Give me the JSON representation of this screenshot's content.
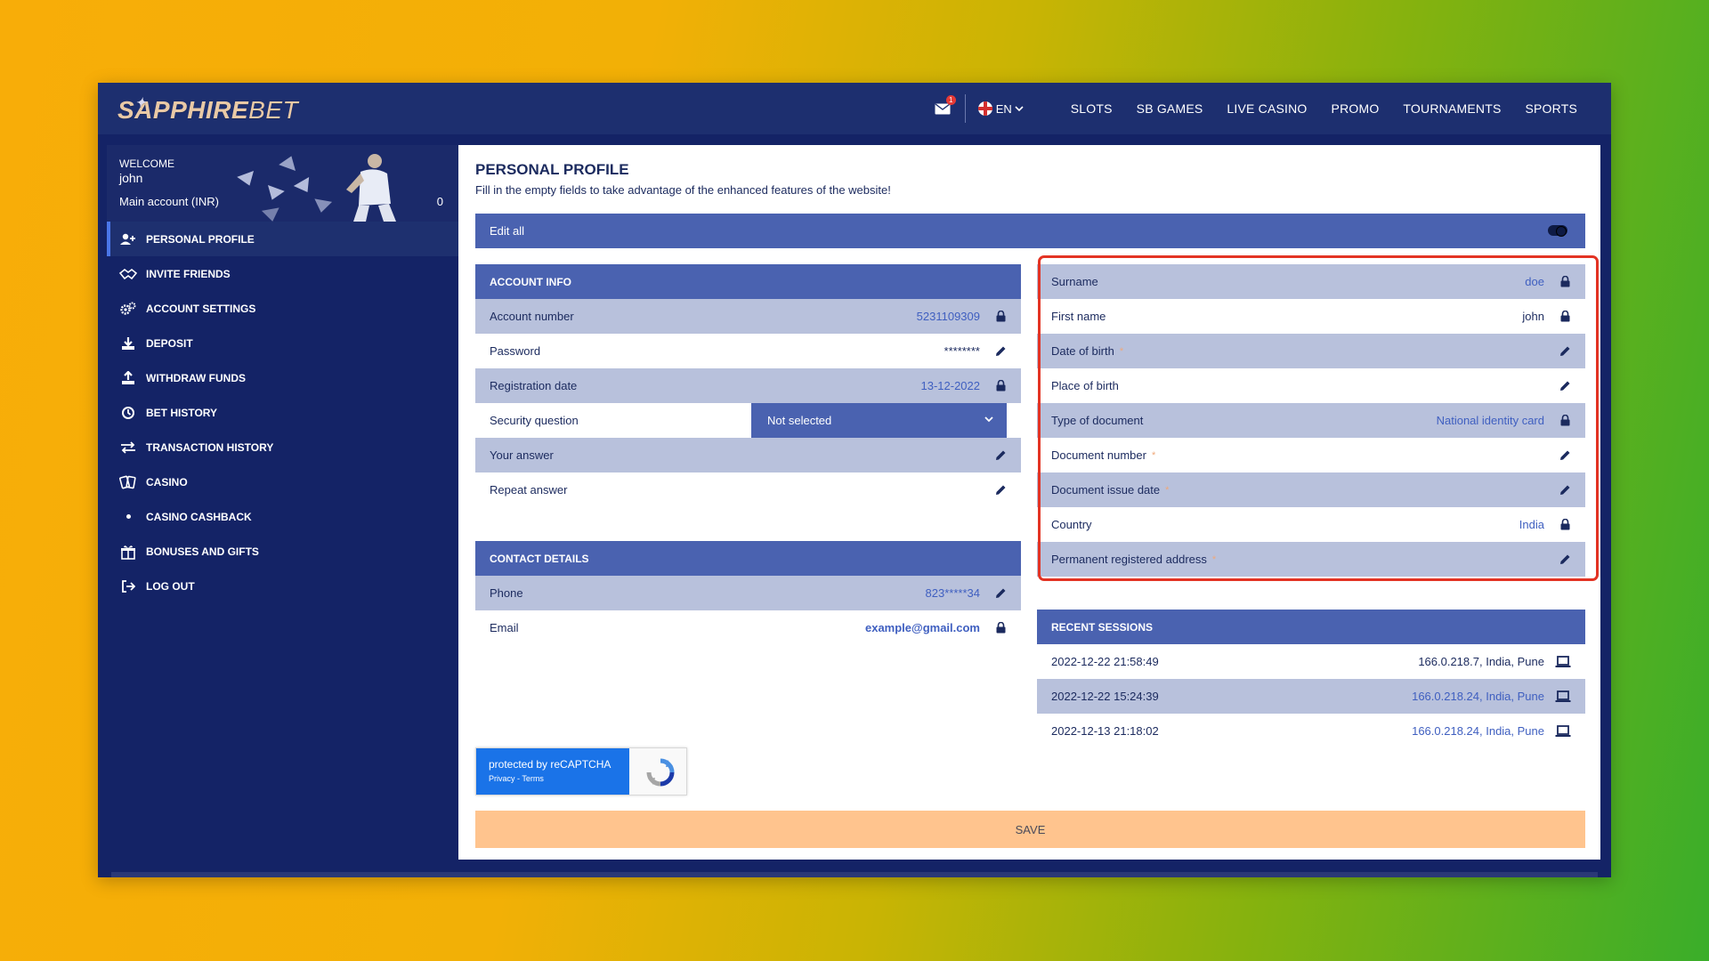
{
  "header": {
    "logo_main": "SAPPHIRE",
    "logo_suffix": "BET",
    "mail_badge": "1",
    "language": "EN",
    "nav": [
      "SLOTS",
      "SB GAMES",
      "LIVE CASINO",
      "PROMO",
      "TOURNAMENTS",
      "SPORTS"
    ]
  },
  "sidebar": {
    "welcome_label": "WELCOME",
    "username": "john",
    "account_label": "Main account (INR)",
    "balance": "0",
    "items": [
      {
        "label": "PERSONAL PROFILE",
        "icon": "user-plus-icon"
      },
      {
        "label": "INVITE FRIENDS",
        "icon": "handshake-icon"
      },
      {
        "label": "ACCOUNT SETTINGS",
        "icon": "gears-icon"
      },
      {
        "label": "DEPOSIT",
        "icon": "download-icon"
      },
      {
        "label": "WITHDRAW FUNDS",
        "icon": "upload-icon"
      },
      {
        "label": "BET HISTORY",
        "icon": "clock-icon"
      },
      {
        "label": "TRANSACTION HISTORY",
        "icon": "arrows-icon"
      },
      {
        "label": "CASINO",
        "icon": "cards-icon"
      },
      {
        "label": "CASINO CASHBACK",
        "icon": "dot-icon"
      },
      {
        "label": "BONUSES AND GIFTS",
        "icon": "gift-icon"
      },
      {
        "label": "LOG OUT",
        "icon": "logout-icon"
      }
    ]
  },
  "main": {
    "title": "PERSONAL PROFILE",
    "subtitle": "Fill in the empty fields to take advantage of the enhanced features of the website!",
    "edit_all": "Edit all",
    "account_info": {
      "heading": "ACCOUNT INFO",
      "account_number_label": "Account number",
      "account_number": "5231109309",
      "password_label": "Password",
      "password": "********",
      "registration_label": "Registration date",
      "registration_date": "13-12-2022",
      "security_question_label": "Security question",
      "security_question_value": "Not selected",
      "your_answer_label": "Your answer",
      "repeat_answer_label": "Repeat answer"
    },
    "contact": {
      "heading": "CONTACT DETAILS",
      "phone_label": "Phone",
      "phone": "823*****34",
      "email_label": "Email",
      "email": "example@gmail.com"
    },
    "personal": {
      "surname_label": "Surname",
      "surname": "doe",
      "first_name_label": "First name",
      "first_name": "john",
      "dob_label": "Date of birth",
      "pob_label": "Place of birth",
      "doc_type_label": "Type of document",
      "doc_type": "National identity card",
      "doc_number_label": "Document number",
      "doc_issue_label": "Document issue date",
      "country_label": "Country",
      "country": "India",
      "address_label": "Permanent registered address",
      "required_mark": "*"
    },
    "sessions": {
      "heading": "RECENT SESSIONS",
      "rows": [
        {
          "time": "2022-12-22 21:58:49",
          "info": "166.0.218.7, India, Pune"
        },
        {
          "time": "2022-12-22 15:24:39",
          "info": "166.0.218.24, India, Pune"
        },
        {
          "time": "2022-12-13 21:18:02",
          "info": "166.0.218.24, India, Pune"
        }
      ]
    },
    "recaptcha": {
      "line1": "protected by reCAPTCHA",
      "line2": "Privacy - Terms"
    },
    "save": "SAVE"
  },
  "colors": {
    "accent": "#4a62b0",
    "highlight": "#e33323",
    "save": "#ffc48e",
    "sidebar": "#142366"
  }
}
